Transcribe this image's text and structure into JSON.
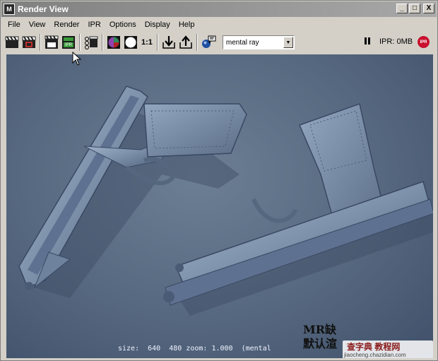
{
  "window": {
    "title": "Render View",
    "app_icon_label": "M"
  },
  "window_controls": {
    "minimize": "_",
    "maximize": "□",
    "close": "X"
  },
  "menu": [
    "File",
    "View",
    "Render",
    "IPR",
    "Options",
    "Display",
    "Help"
  ],
  "toolbar": {
    "ratio_label": "1:1",
    "renderer": "mental ray",
    "ipr_status": "IPR: 0MB",
    "ipr_stop_label": "IPR",
    "ipr_badge": "IPR"
  },
  "viewport": {
    "status_line": "size:  640  480 zoom: 1.000  (mental"
  },
  "watermark": {
    "main_line1": "MR缺",
    "main_line2": "默认渲",
    "site_title": "查字典 教程网",
    "site_url": "jiaocheng.chazidian.com"
  },
  "colors": {
    "viewport_bg": "#56687f",
    "title_bar": "#808080",
    "window_bg": "#d4d0c8",
    "ipr_stop": "#c8102e",
    "pistol": "#7e92ab"
  }
}
